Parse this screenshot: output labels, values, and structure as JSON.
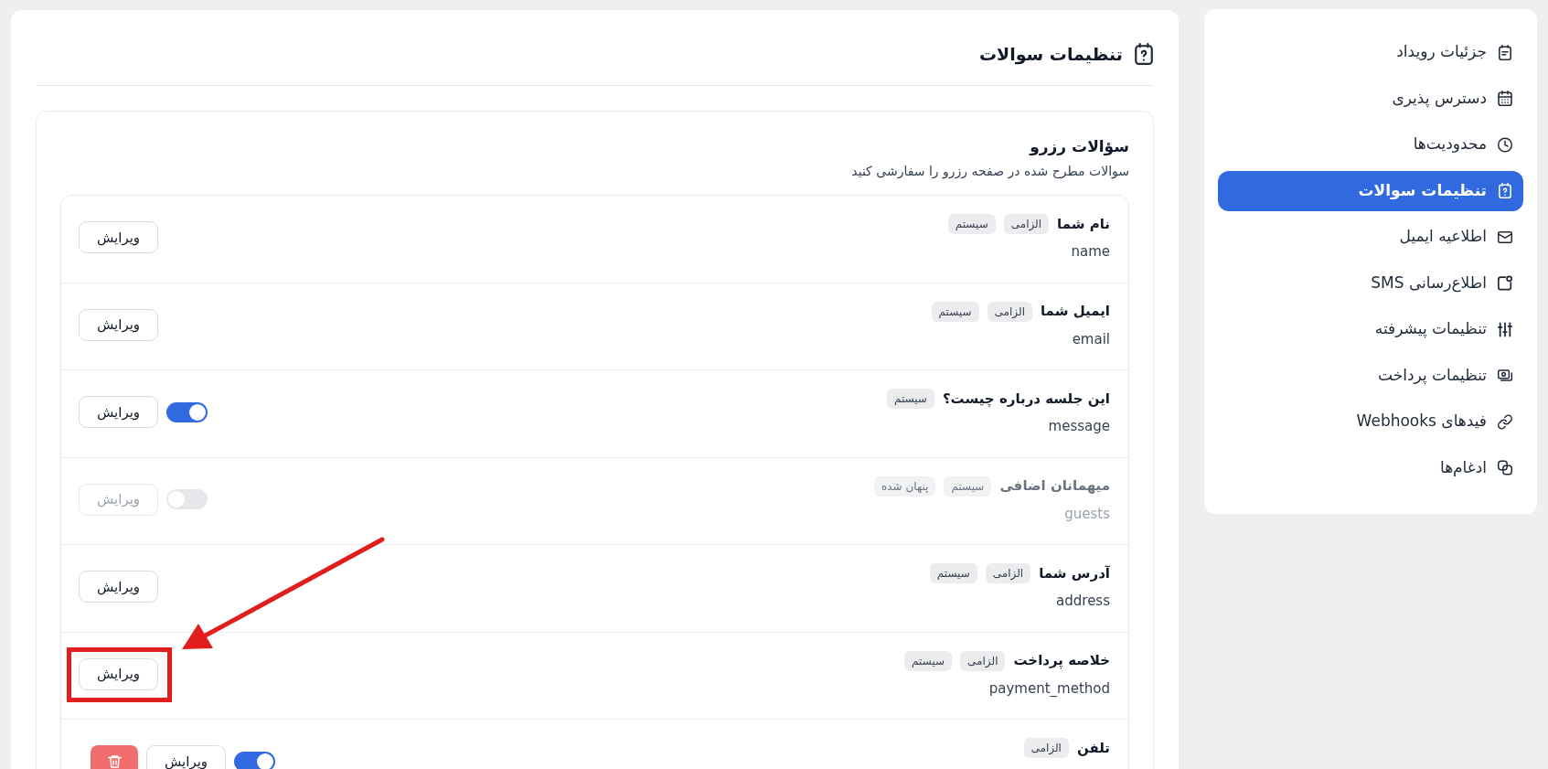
{
  "sidebar": {
    "items": [
      {
        "label": "جزئیات رویداد",
        "selected": false
      },
      {
        "label": "دسترس پذیری",
        "selected": false
      },
      {
        "label": "محدودیت‌ها",
        "selected": false
      },
      {
        "label": "تنظیمات سوالات",
        "selected": true
      },
      {
        "label": "اطلاعیه ایمیل",
        "selected": false
      },
      {
        "label": "اطلاع‌رسانی SMS",
        "selected": false
      },
      {
        "label": "تنظیمات پیشرفته",
        "selected": false
      },
      {
        "label": "تنظیمات پرداخت",
        "selected": false
      },
      {
        "label": "فیدهای Webhooks",
        "selected": false
      },
      {
        "label": "ادغام‌ها",
        "selected": false
      }
    ]
  },
  "header": {
    "title": "تنظیمات سوالات"
  },
  "section": {
    "title": "سؤالات رزرو",
    "subtitle": "سوالات مطرح شده در صفحه رزرو را سفارشی کنید"
  },
  "questions": [
    {
      "title": "نام شما",
      "tags": [
        "الزامی",
        "سیستم"
      ],
      "key": "name",
      "button": "ویرایش",
      "disabled": false,
      "deletable": false,
      "highlighted": false
    },
    {
      "title": "ایمیل شما",
      "tags": [
        "الزامی",
        "سیستم"
      ],
      "key": "email",
      "button": "ویرایش",
      "disabled": false,
      "deletable": false,
      "highlighted": false
    },
    {
      "title": "این جلسه درباره چیست؟",
      "tags": [
        "سیستم"
      ],
      "key": "message",
      "button": "ویرایش",
      "toggle": {
        "on": true
      },
      "disabled": false,
      "deletable": false,
      "highlighted": false
    },
    {
      "title": "میهمانان اضافی",
      "tags": [
        "سیستم",
        "پنهان شده"
      ],
      "key": "guests",
      "button": "ویرایش",
      "toggle": {
        "on": false
      },
      "disabled": true,
      "deletable": false,
      "highlighted": false
    },
    {
      "title": "آدرس شما",
      "tags": [
        "الزامی",
        "سیستم"
      ],
      "key": "address",
      "button": "ویرایش",
      "disabled": false,
      "deletable": false,
      "highlighted": false
    },
    {
      "title": "خلاصه پرداخت",
      "tags": [
        "الزامی",
        "سیستم"
      ],
      "key": "payment_method",
      "button": "ویرایش",
      "disabled": false,
      "deletable": false,
      "highlighted": true
    },
    {
      "title": "تلفن",
      "tags": [
        "الزامی"
      ],
      "button": "ویرایش",
      "toggle": {
        "on": true
      },
      "disabled": false,
      "deletable": true,
      "highlighted": false
    }
  ]
}
